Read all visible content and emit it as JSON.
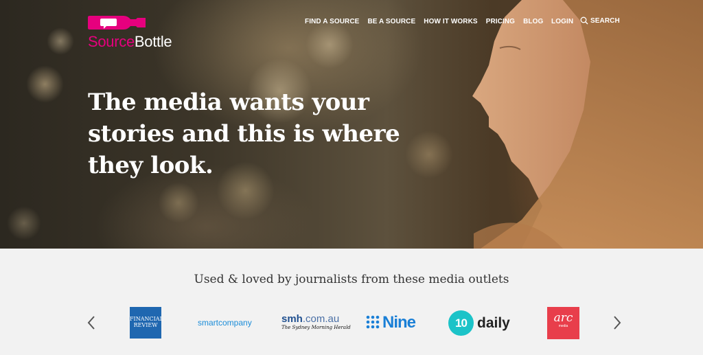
{
  "brand": {
    "name_part1": "Source",
    "name_part2": "Bottle",
    "primary_color": "#e6007e"
  },
  "nav": {
    "items": [
      "FIND A SOURCE",
      "BE A SOURCE",
      "HOW IT WORKS",
      "PRICING",
      "BLOG"
    ],
    "login": "LOGIN",
    "search": "SEARCH"
  },
  "hero": {
    "headline_line1": "The media wants your",
    "headline_line2": "stories and this is where",
    "headline_line3": "they look."
  },
  "outlets": {
    "title": "Used & loved by journalists from these media outlets",
    "logos": {
      "afr_line1": "FINANCIAL",
      "afr_line2": "REVIEW",
      "smartcompany": "smartcompany",
      "smh_main": "smh",
      "smh_domain": ".com.au",
      "smh_sub": "The Sydney Morning Herald",
      "nine": "Nine",
      "ten_number": "10",
      "ten_word": "daily",
      "arc_main": "arc",
      "arc_sub": "media"
    }
  },
  "icons": {
    "search": "search-icon",
    "left": "chevron-left-icon",
    "right": "chevron-right-icon"
  }
}
